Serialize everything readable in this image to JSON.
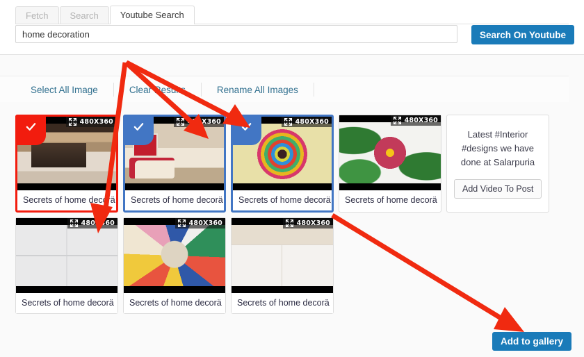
{
  "tabs": [
    {
      "label": "Fetch",
      "active": false
    },
    {
      "label": "Search",
      "active": false
    },
    {
      "label": "Youtube Search",
      "active": true
    }
  ],
  "search": {
    "value": "home decoration",
    "placeholder": "home decoration",
    "button_label": "Search On Youtube"
  },
  "toolbar": {
    "select_all_label": "Select All Image",
    "clear_results_label": "Clear Results",
    "rename_all_label": "Rename All Images"
  },
  "gallery": {
    "dimension_badge": "480X360",
    "cards": [
      {
        "title": "Secrets of home decorä",
        "selected": true,
        "select_color": "#f21c0e",
        "image": "img-living"
      },
      {
        "title": "Secrets of home decorä",
        "selected": true,
        "select_color": "#4276c4",
        "image": "img-sofa"
      },
      {
        "title": "Secrets of home decorä",
        "selected": true,
        "select_color": "#4276c4",
        "image": "img-quill"
      },
      {
        "title": "Secrets of home decorä",
        "selected": false,
        "select_color": "",
        "image": "img-flower"
      },
      {
        "title": "Secrets of home decorä",
        "selected": false,
        "select_color": "",
        "image": "img-news"
      },
      {
        "title": "Secrets of home decorä",
        "selected": false,
        "select_color": "",
        "image": "img-wreath"
      },
      {
        "title": "Secrets of home decorä",
        "selected": false,
        "select_color": "",
        "image": "img-white"
      }
    ],
    "text_card": {
      "text": "Latest #Interior #designs we have done at Salarpuria",
      "button_label": "Add Video To Post"
    }
  },
  "footer": {
    "add_to_gallery_label": "Add to gallery"
  },
  "colors": {
    "accent_blue": "#1a7bb9",
    "selection_red": "#f21c0e",
    "selection_blue": "#4276c4",
    "link_blue": "#31708f",
    "annotation_red": "#f02a10"
  },
  "icons": {
    "expand": "expand-icon",
    "check": "check-icon"
  }
}
